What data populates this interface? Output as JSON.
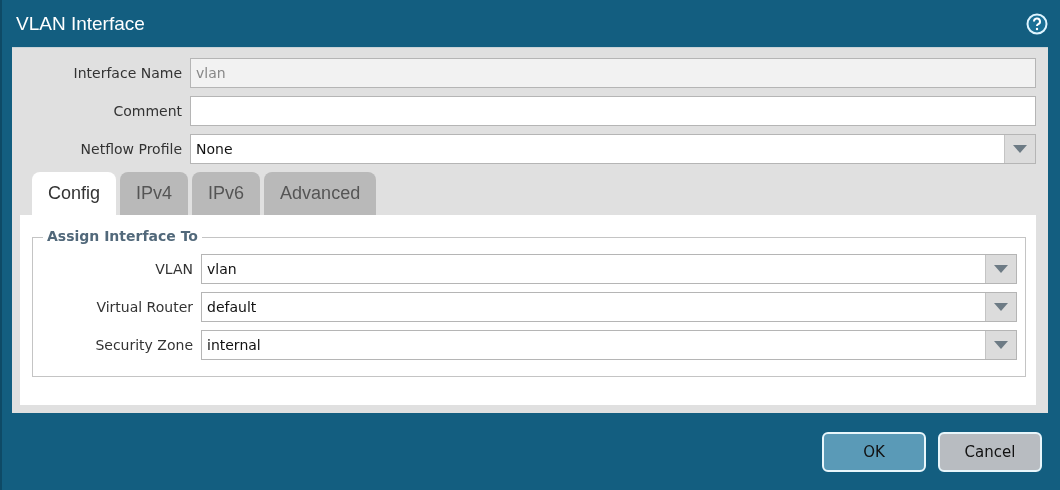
{
  "window": {
    "title": "VLAN Interface"
  },
  "fields": [
    {
      "label": "Interface Name",
      "kind": "text",
      "value": "vlan",
      "disabled": true
    },
    {
      "label": "Comment",
      "kind": "text",
      "disabled": false
    },
    {
      "label": "Netflow Profile",
      "kind": "select",
      "value": "None",
      "disabled": false
    }
  ],
  "tabs": [
    {
      "label": "Config",
      "selected": true
    },
    {
      "label": "IPv4",
      "selected": false
    },
    {
      "label": "IPv6",
      "selected": false
    },
    {
      "label": "Advanced",
      "selected": false
    }
  ],
  "group": {
    "title": "Assign Interface To",
    "fields": [
      {
        "label": "VLAN",
        "kind": "select",
        "value": "vlan"
      },
      {
        "label": "Virtual Router",
        "kind": "select",
        "value": "default"
      },
      {
        "label": "Security Zone",
        "kind": "select",
        "value": "internal"
      }
    ]
  },
  "buttons": [
    {
      "label": "OK",
      "kind": "primary"
    },
    {
      "label": "Cancel",
      "kind": "secondary"
    }
  ]
}
